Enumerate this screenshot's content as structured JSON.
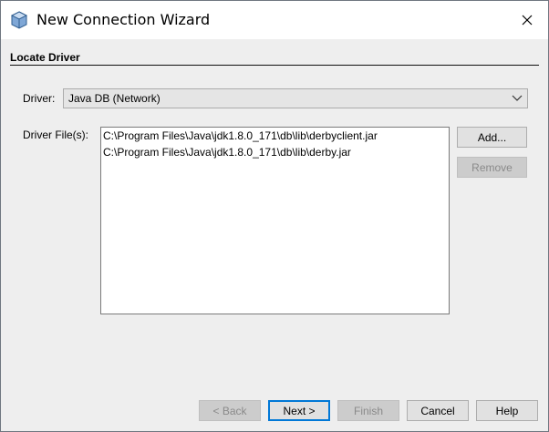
{
  "window": {
    "title": "New Connection Wizard"
  },
  "step": {
    "title": "Locate Driver"
  },
  "driver": {
    "label": "Driver:",
    "selected": "Java DB (Network)"
  },
  "driver_files": {
    "label": "Driver File(s):",
    "items": [
      "C:\\Program Files\\Java\\jdk1.8.0_171\\db\\lib\\derbyclient.jar",
      "C:\\Program Files\\Java\\jdk1.8.0_171\\db\\lib\\derby.jar"
    ],
    "add_label": "Add...",
    "remove_label": "Remove"
  },
  "footer": {
    "back_label": "< Back",
    "next_label": "Next >",
    "finish_label": "Finish",
    "cancel_label": "Cancel",
    "help_label": "Help"
  }
}
